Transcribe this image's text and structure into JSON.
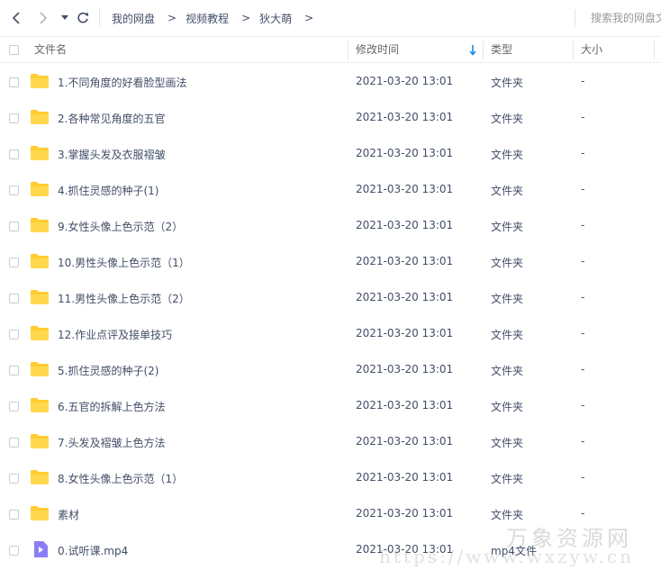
{
  "toolbar": {
    "breadcrumbs": [
      "我的网盘",
      "视频教程",
      "狄大萌"
    ],
    "separator": ">",
    "search_placeholder": "搜索我的网盘文件"
  },
  "columns": {
    "name": "文件名",
    "modified": "修改时间",
    "type": "类型",
    "size": "大小"
  },
  "files": [
    {
      "name": "1.不同角度的好看脸型画法",
      "modified": "2021-03-20 13:01",
      "type": "文件夹",
      "size": "-",
      "icon": "folder-icon"
    },
    {
      "name": "2.各种常见角度的五官",
      "modified": "2021-03-20 13:01",
      "type": "文件夹",
      "size": "-",
      "icon": "folder-icon"
    },
    {
      "name": "3.掌握头发及衣服褶皱",
      "modified": "2021-03-20 13:01",
      "type": "文件夹",
      "size": "-",
      "icon": "folder-icon"
    },
    {
      "name": "4.抓住灵感的种子(1)",
      "modified": "2021-03-20 13:01",
      "type": "文件夹",
      "size": "-",
      "icon": "folder-icon"
    },
    {
      "name": "9.女性头像上色示范（2）",
      "modified": "2021-03-20 13:01",
      "type": "文件夹",
      "size": "-",
      "icon": "folder-icon"
    },
    {
      "name": "10.男性头像上色示范（1）",
      "modified": "2021-03-20 13:01",
      "type": "文件夹",
      "size": "-",
      "icon": "folder-icon"
    },
    {
      "name": "11.男性头像上色示范（2）",
      "modified": "2021-03-20 13:01",
      "type": "文件夹",
      "size": "-",
      "icon": "folder-icon"
    },
    {
      "name": "12.作业点评及接单技巧",
      "modified": "2021-03-20 13:01",
      "type": "文件夹",
      "size": "-",
      "icon": "folder-icon"
    },
    {
      "name": "5.抓住灵感的种子(2)",
      "modified": "2021-03-20 13:01",
      "type": "文件夹",
      "size": "-",
      "icon": "folder-icon"
    },
    {
      "name": "6.五官的拆解上色方法",
      "modified": "2021-03-20 13:01",
      "type": "文件夹",
      "size": "-",
      "icon": "folder-icon"
    },
    {
      "name": "7.头发及褶皱上色方法",
      "modified": "2021-03-20 13:01",
      "type": "文件夹",
      "size": "-",
      "icon": "folder-icon"
    },
    {
      "name": "8.女性头像上色示范（1）",
      "modified": "2021-03-20 13:01",
      "type": "文件夹",
      "size": "-",
      "icon": "folder-icon"
    },
    {
      "name": "素材",
      "modified": "2021-03-20 13:01",
      "type": "文件夹",
      "size": "-",
      "icon": "folder-icon"
    },
    {
      "name": "0.试听课.mp4",
      "modified": "2021-03-20 13:01",
      "type": "mp4文件",
      "size": "",
      "icon": "video-file-icon"
    }
  ],
  "watermark": {
    "line1": "万象资源网",
    "line2": "https://www.wxzyw.cn"
  },
  "colors": {
    "folder": "#ffcc33",
    "video": "#8a7ef7",
    "sort_arrow": "#1e88e5"
  }
}
